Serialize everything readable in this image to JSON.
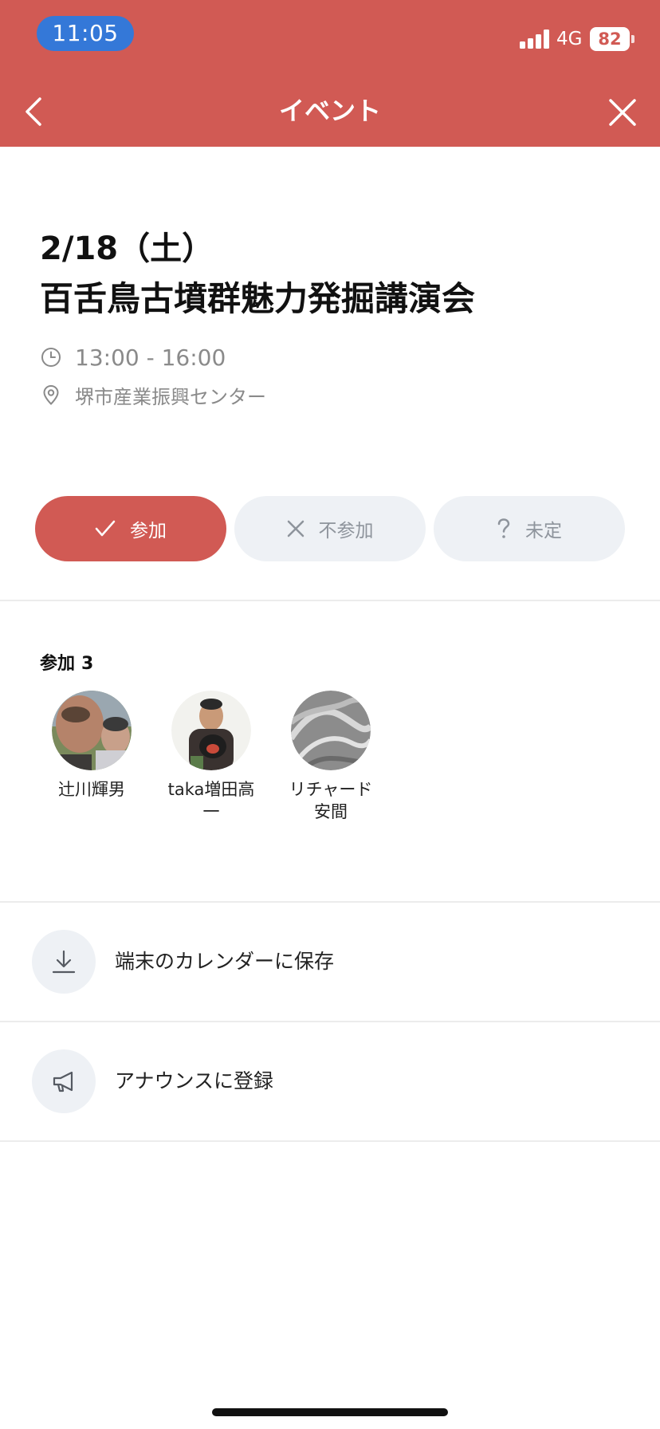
{
  "status_bar": {
    "time": "11:05",
    "network": "4G",
    "battery": "82"
  },
  "header": {
    "title": "イベント",
    "back_icon": "chevron-left-icon",
    "close_icon": "close-icon",
    "background_color": "#d15a54"
  },
  "event": {
    "date": "2/18（土）",
    "title": "百舌鳥古墳群魅力発掘講演会",
    "time_range": "13:00 - 16:00",
    "location": "堺市産業振興センター"
  },
  "rsvp": {
    "join_label": "参加",
    "decline_label": "不参加",
    "undecided_label": "未定",
    "selected": "join"
  },
  "participants": {
    "label": "参加",
    "count": "3",
    "members": [
      {
        "name": "辻川輝男"
      },
      {
        "name": "taka増田高一"
      },
      {
        "name": "リチャード安間"
      }
    ]
  },
  "actions": {
    "save_calendar_label": "端末のカレンダーに保存",
    "announce_label": "アナウンスに登録"
  }
}
